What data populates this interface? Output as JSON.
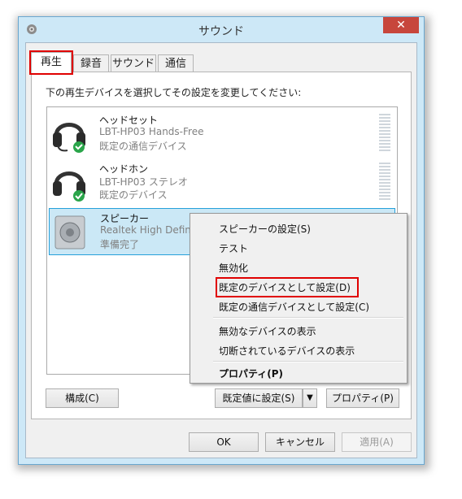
{
  "window": {
    "title": "サウンド",
    "close_label": "✕"
  },
  "tabs": [
    {
      "label": "再生",
      "active": true
    },
    {
      "label": "録音"
    },
    {
      "label": "サウンド"
    },
    {
      "label": "通信"
    }
  ],
  "instruction": "下の再生デバイスを選択してその設定を変更してください:",
  "devices": [
    {
      "name": "ヘッドセット",
      "model": "LBT-HP03 Hands-Free",
      "status": "既定の通信デバイス",
      "icon": "headset-phone-icon"
    },
    {
      "name": "ヘッドホン",
      "model": "LBT-HP03 ステレオ",
      "status": "既定のデバイス",
      "icon": "headphones-check-icon"
    },
    {
      "name": "スピーカー",
      "model": "Realtek High Defin",
      "status": "準備完了",
      "icon": "speaker-icon",
      "selected": true
    }
  ],
  "buttons": {
    "configure": "構成(C)",
    "set_default": "既定値に設定(S)",
    "dropdown": "▼",
    "properties": "プロパティ(P)",
    "ok": "OK",
    "cancel": "キャンセル",
    "apply": "適用(A)"
  },
  "context_menu": {
    "items": [
      {
        "label": "スピーカーの設定(S)"
      },
      {
        "label": "テスト"
      },
      {
        "label": "無効化"
      },
      {
        "label": "既定のデバイスとして設定(D)",
        "highlighted": true
      },
      {
        "label": "既定の通信デバイスとして設定(C)"
      },
      {
        "label": "無効なデバイスの表示"
      },
      {
        "label": "切断されているデバイスの表示"
      },
      {
        "label": "プロパティ(P)",
        "bold": true
      }
    ]
  },
  "colors": {
    "highlight_box": "#e00000",
    "selection": "#cbe8f6",
    "close": "#c7463c",
    "frame": "#cde8f7"
  }
}
